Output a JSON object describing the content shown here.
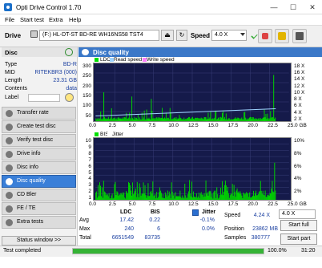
{
  "window": {
    "title": "Opti Drive Control 1.70",
    "minimize": "—",
    "maximize": "☐",
    "close": "✕"
  },
  "menu": [
    "File",
    "Start test",
    "Extra",
    "Help"
  ],
  "toolbar": {
    "drive_label": "Drive",
    "drive_value": "(F:)  HL-DT-ST BD-RE  WH16NS58 TST4",
    "speed_label": "Speed",
    "speed_value": "4.0 X"
  },
  "disc": {
    "header": "Disc",
    "rows": [
      {
        "k": "Type",
        "v": "BD-R"
      },
      {
        "k": "MID",
        "v": "RITEKBR3 (000)"
      },
      {
        "k": "Length",
        "v": "23.31 GB"
      },
      {
        "k": "Contents",
        "v": "data"
      },
      {
        "k": "Label",
        "v": ""
      }
    ]
  },
  "nav": [
    "Transfer rate",
    "Create test disc",
    "Verify test disc",
    "Drive info",
    "Disc info",
    "Disc quality",
    "CD Bler",
    "FE / TE",
    "Extra tests"
  ],
  "nav_selected": 5,
  "status_window_btn": "Status window >>",
  "panel": {
    "title": "Disc quality"
  },
  "chart_top": {
    "legend": [
      "LDC",
      "Read speed",
      "Write speed"
    ],
    "y_left": [
      "300",
      "250",
      "200",
      "150",
      "100",
      "50"
    ],
    "y_right": [
      "18 X",
      "16 X",
      "14 X",
      "12 X",
      "10 X",
      "8 X",
      "6 X",
      "4 X",
      "2 X"
    ],
    "x": [
      "0.0",
      "2.5",
      "5.0",
      "7.5",
      "10.0",
      "12.5",
      "15.0",
      "17.5",
      "20.0",
      "22.5",
      "25.0 GB"
    ]
  },
  "chart_bottom": {
    "legend": [
      "BIS",
      "Jitter"
    ],
    "y_left": [
      "10",
      "9",
      "8",
      "7",
      "6",
      "5",
      "4",
      "3",
      "2",
      "1"
    ],
    "y_right": [
      "10%",
      "8%",
      "6%",
      "4%",
      "2%"
    ],
    "x": [
      "0.0",
      "2.5",
      "5.0",
      "7.5",
      "10.0",
      "12.5",
      "15.0",
      "17.5",
      "20.0",
      "22.5",
      "25.0 GB"
    ]
  },
  "chart_data": {
    "type": "bar",
    "ldc_ymax": 300,
    "bis_ymax": 10,
    "xlim": [
      0,
      25
    ],
    "read_speed_x": [
      0,
      23.3
    ],
    "read_speed_y": [
      1.8,
      4.3
    ]
  },
  "stats": {
    "cols": [
      "LDC",
      "BIS"
    ],
    "rows": [
      {
        "k": "Avg",
        "ldc": "17.42",
        "bis": "0.22"
      },
      {
        "k": "Max",
        "ldc": "240",
        "bis": "6"
      },
      {
        "k": "Total",
        "ldc": "6651549",
        "bis": "83735"
      }
    ],
    "jitter_label": "Jitter",
    "jitter_avg": "-0.1%",
    "jitter_max": "0.0%",
    "speed_label": "Speed",
    "speed_value": "4.24 X",
    "speed_select": "4.0 X",
    "position_label": "Position",
    "position_value": "23862 MB",
    "samples_label": "Samples",
    "samples_value": "380777",
    "start_full": "Start full",
    "start_part": "Start part"
  },
  "statusbar": {
    "text": "Test completed",
    "progress": 100.0,
    "percent": "100.0%",
    "time": "31:20"
  }
}
